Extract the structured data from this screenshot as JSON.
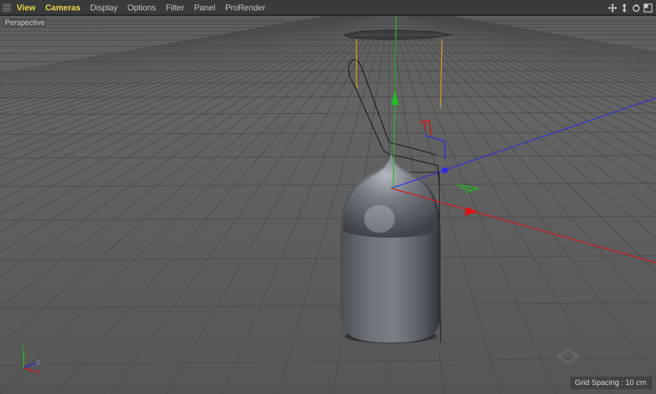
{
  "menubar": {
    "items": [
      {
        "label": "View",
        "active": true
      },
      {
        "label": "Cameras",
        "active": true
      },
      {
        "label": "Display",
        "active": false
      },
      {
        "label": "Options",
        "active": false
      },
      {
        "label": "Filter",
        "active": false
      },
      {
        "label": "Panel",
        "active": false
      },
      {
        "label": "ProRender",
        "active": false
      }
    ],
    "nav_icons": [
      "move-view-icon",
      "zoom-view-icon",
      "rotate-view-icon",
      "toggle-views-icon"
    ]
  },
  "viewport": {
    "camera_label": "Perspective",
    "grid_spacing": "Grid Spacing : 10 cm",
    "world_axes": {
      "y": "Y",
      "z": "Z",
      "x": "X"
    }
  },
  "colors": {
    "menu_active": "#f2d94e",
    "axis_x": "#e01010",
    "axis_y": "#20c020",
    "axis_z": "#2a2ae0",
    "selection": "#e0a020"
  }
}
